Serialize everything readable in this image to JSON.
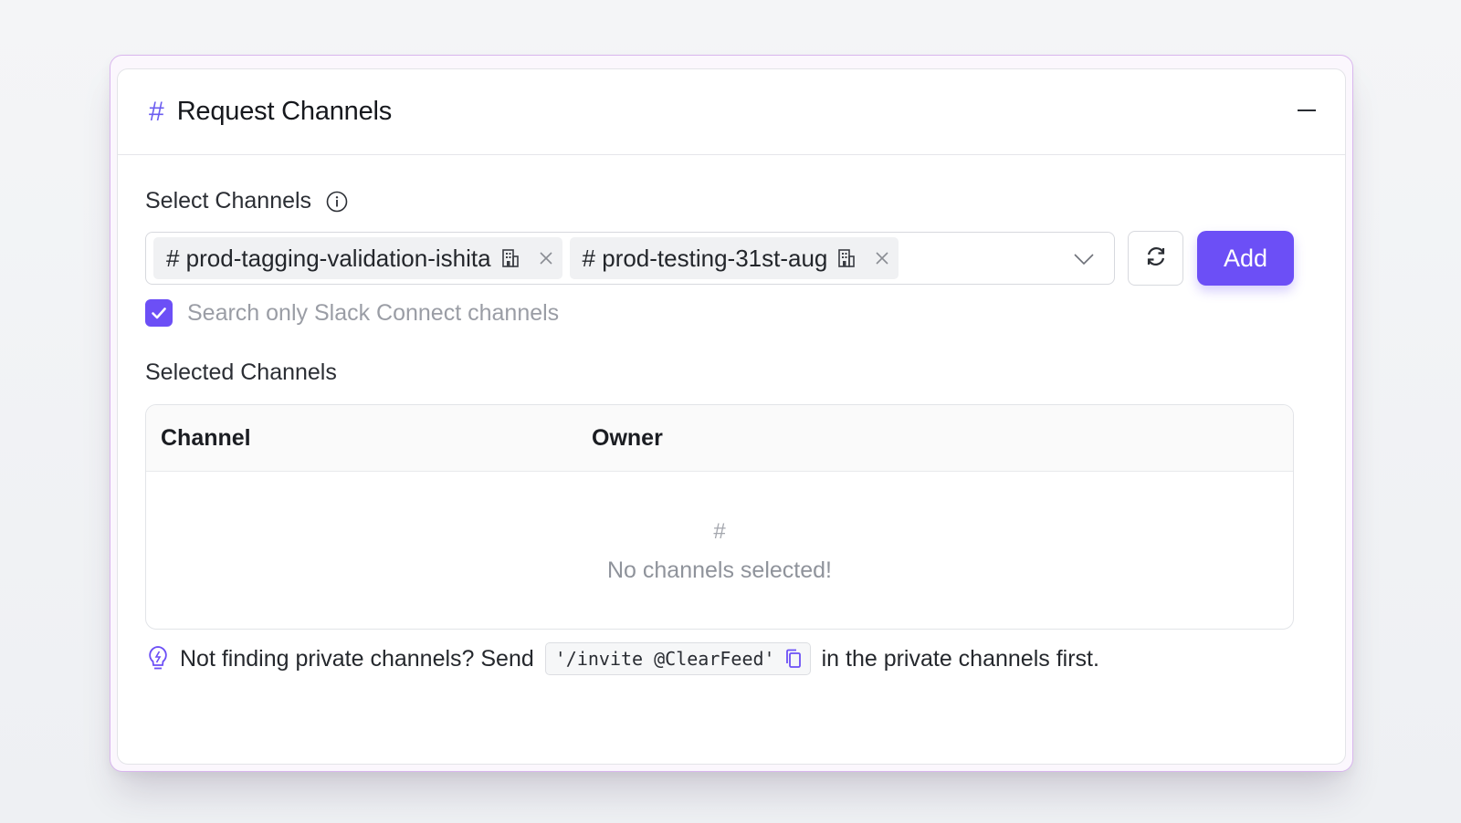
{
  "card": {
    "title": "Request Channels",
    "title_icon": "#"
  },
  "select": {
    "label": "Select Channels",
    "tags": [
      {
        "label": "# prod-tagging-validation-ishita"
      },
      {
        "label": "# prod-testing-31st-aug"
      }
    ],
    "add_label": "Add"
  },
  "filter": {
    "label": "Search only Slack Connect channels",
    "checked": true
  },
  "selected": {
    "label": "Selected Channels",
    "columns": [
      "Channel",
      "Owner"
    ],
    "empty_icon": "#",
    "empty_text": "No channels selected!"
  },
  "tip": {
    "before": "Not finding private channels? Send",
    "code": "'/invite @ClearFeed'",
    "after": "in the private channels first."
  },
  "colors": {
    "accent": "#6c4ff6",
    "frame": "#d9b6ee"
  },
  "icons": [
    "hash-icon",
    "minus-icon",
    "info-icon",
    "building-icon",
    "close-icon",
    "chevron-down-icon",
    "refresh-icon",
    "check-icon",
    "lightbulb-icon",
    "copy-icon"
  ]
}
